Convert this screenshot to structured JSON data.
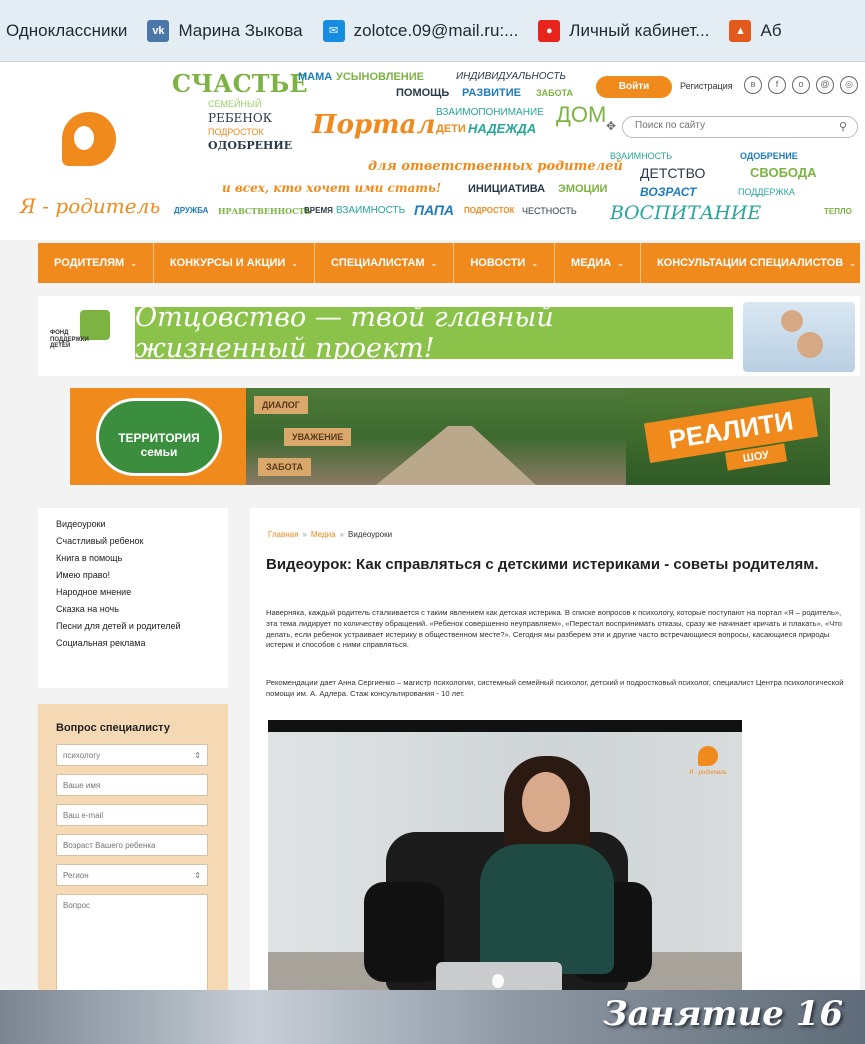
{
  "bookmarks": [
    {
      "label": "Одноклассники",
      "icon": "odnoklassniki-icon"
    },
    {
      "label": "Марина Зыкова",
      "icon": "vk-icon"
    },
    {
      "label": "zolotce.09@mail.ru:...",
      "icon": "mail-icon"
    },
    {
      "label": "Личный кабинет...",
      "icon": "red-square-icon"
    },
    {
      "label": "Аб",
      "icon": "ab-icon"
    }
  ],
  "header": {
    "logo_text": "Я - родитель",
    "login_label": "Войти",
    "register_label": "Регистрация",
    "search_placeholder": "Поиск по сайту",
    "portal_label": "Портал",
    "tagline1": "для ответственных родителей",
    "tagline2": "и всех, кто хочет ими стать!",
    "cloud_words": {
      "w1": "СЧАСТЬЕ",
      "w2": "МАМА",
      "w3": "УСЫНОВЛЕНИЕ",
      "w4": "ИНДИВИДУАЛЬНОСТЬ",
      "w5": "ПОМОЩЬ",
      "w6": "РАЗВИТИЕ",
      "w7": "ЗАБОТА",
      "w8": "СЕМЕЙНЫЙ",
      "w9": "РЕБЕНОК",
      "w10": "ПОДРОСТОК",
      "w11": "ОДОБРЕНИЕ",
      "w12": "ВЗАИМОПОНИМАНИЕ",
      "w13": "ДЕТИ",
      "w14": "НАДЕЖДА",
      "w15": "ДОМ",
      "w16": "ИНИЦИАТИВА",
      "w17": "ЭМОЦИИ",
      "w18": "ДРУЖБА",
      "w19": "НРАВСТВЕННОСТЬ",
      "w20": "ВРЕМЯ",
      "w21": "ВЗАИМНОСТЬ",
      "w22": "ПАПА",
      "w23": "ПОДРОСТОК",
      "w24": "ЧЕСТНОСТЬ",
      "w25": "ВОСПИТАНИЕ",
      "w26": "ТЕПЛО",
      "w27": "ВЗАИМНОСТЬ",
      "w28": "ОДОБРЕНИЕ",
      "w29": "ДЕТСТВО",
      "w30": "СВОБОДА",
      "w31": "ВОЗРАСТ",
      "w32": "ПОДДЕРЖКА",
      "w33": "МАМА"
    }
  },
  "nav": [
    {
      "label": "РОДИТЕЛЯМ",
      "caret": "⌄"
    },
    {
      "label": "КОНКУРСЫ И АКЦИИ",
      "caret": "⌄"
    },
    {
      "label": "СПЕЦИАЛИСТАМ",
      "caret": "⌄"
    },
    {
      "label": "НОВОСТИ",
      "caret": "⌄"
    },
    {
      "label": "МЕДИА",
      "caret": "⌄"
    },
    {
      "label": "КОНСУЛЬТАЦИИ СПЕЦИАЛИСТОВ",
      "caret": "⌄"
    }
  ],
  "banner1": {
    "fund_text": "ФОНД ПОДДЕРЖКИ ДЕТЕЙ",
    "slogan": "Отцовство — твой главный жизненный проект!"
  },
  "banner2": {
    "badge": "ТЕРРИТОРИЯ семьи",
    "tags": [
      "ДИАЛОГ",
      "УВАЖЕНИЕ",
      "ЗАБОТА"
    ],
    "reality": "РЕАЛИТИ",
    "show": "ШОУ"
  },
  "sidebar": {
    "items": [
      "Видеоуроки",
      "Счастливый ребенок",
      "Книга в помощь",
      "Имею право!",
      "Народное мнение",
      "Сказка на ночь",
      "Песни для детей и родителей",
      "Социальная реклама"
    ]
  },
  "question_form": {
    "title": "Вопрос специалисту",
    "specialist_select": "психологу",
    "name_placeholder": "Ваше имя",
    "email_placeholder": "Ваш e-mail",
    "child_age_placeholder": "Возраст Вашего ребенка",
    "region_select": "Регион",
    "question_placeholder": "Вопрос",
    "select_arrow": "⇕"
  },
  "breadcrumbs": {
    "home": "Главная",
    "media": "Медиа",
    "current": "Видеоуроки",
    "sep": "»"
  },
  "article": {
    "title": "Видеоурок: Как справляться с детскими истериками - советы родителям.",
    "paragraph1": "Наверняка, каждый родитель сталкивается с таким явлением как детская истерика. В списке вопросов к психологу, которые поступают на портал «Я – родитель», эта тема лидирует по количеству обращений. «Ребенок совершенно неуправляем», «Перестал воспринимать отказы, сразу же начинает кричать и плакать», «Что делать, если ребенок устраивает истерику в общественном месте?». Сегодня мы разберем эти и другие часто встречающиеся вопросы, касающиеся природы истерик и способов с ними справляться.",
    "paragraph2": "Рекомендации дает Анна Сергиенко – магистр психологии, системный семейный психолог, детский и подростковый психолог, специалист Центра психологической помощи им. А. Адлера. Стаж консультирования - 10 лет.",
    "video_logo": "Я - родитель"
  },
  "overlay": {
    "lesson": "Занятие 16"
  },
  "colors": {
    "accent_orange": "#f08a1c",
    "accent_green": "#8bc34a"
  }
}
